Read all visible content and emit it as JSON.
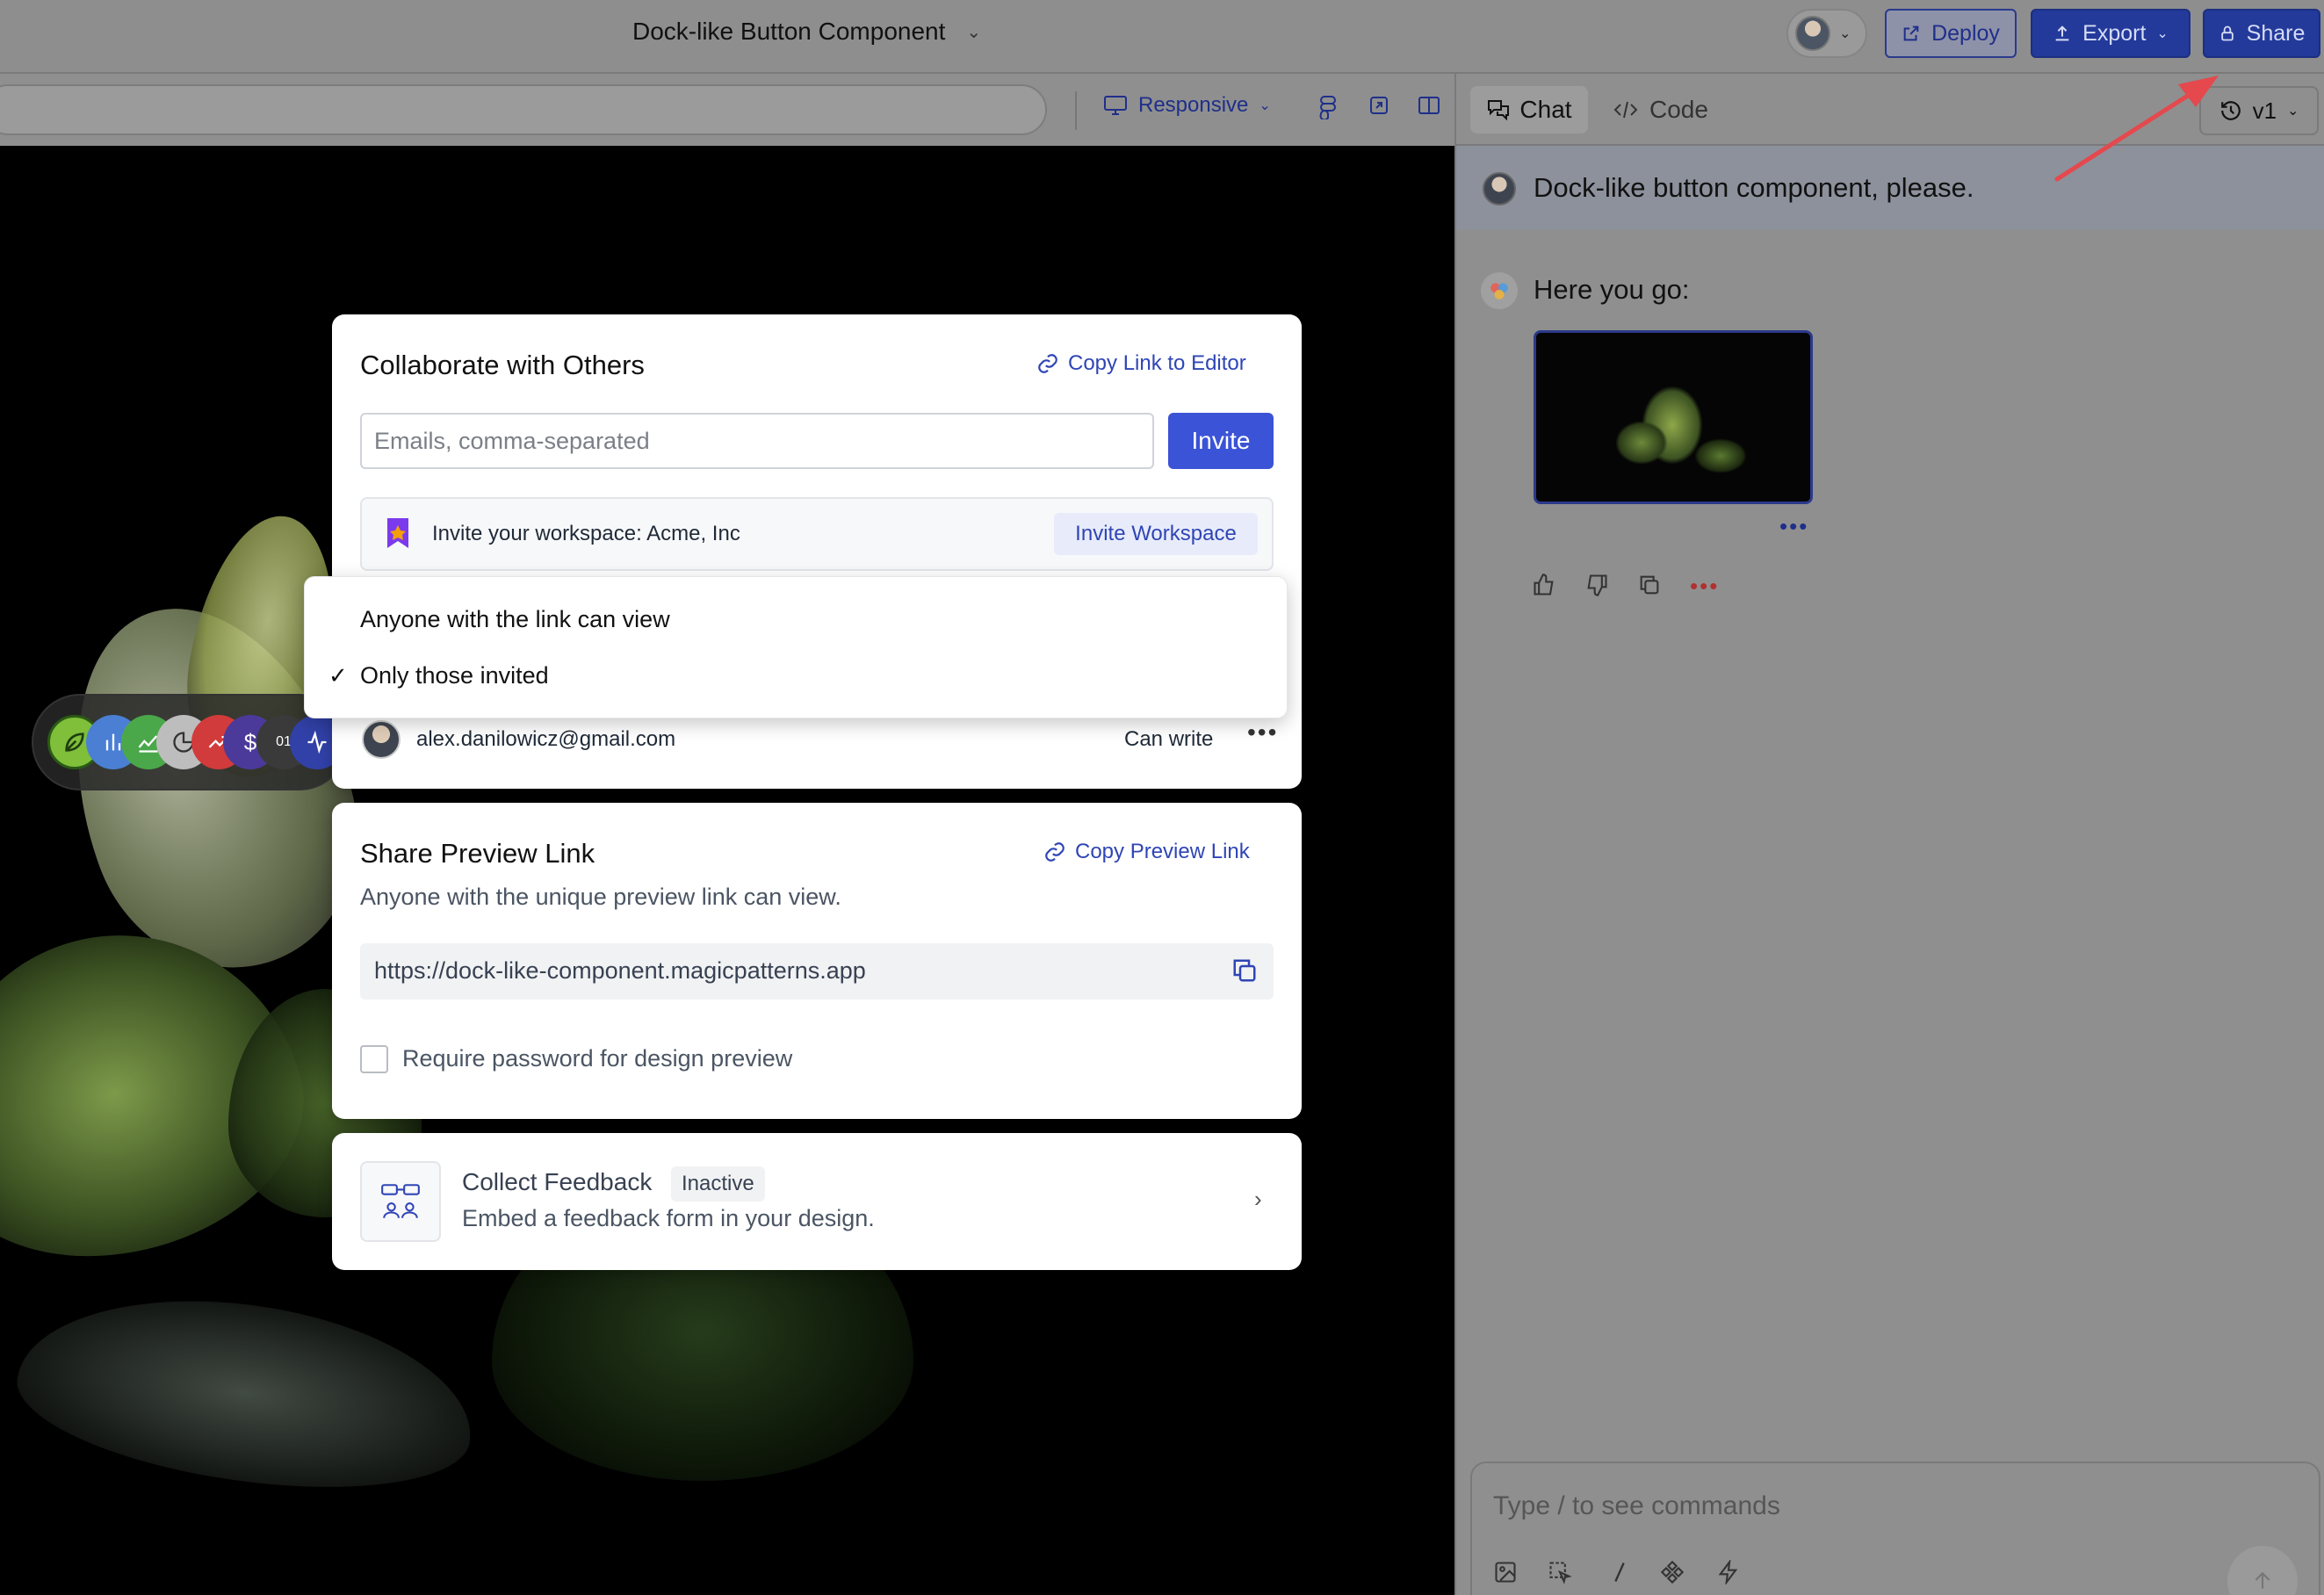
{
  "header": {
    "doc_title": "Dock-like Button Component",
    "deploy_label": "Deploy",
    "export_label": "Export",
    "share_label": "Share"
  },
  "toolbar": {
    "responsive_label": "Responsive",
    "tab_chat": "Chat",
    "tab_code": "Code",
    "version": "v1"
  },
  "chat": {
    "user_message": "Dock-like button component, please.",
    "bot_message": "Here you go:",
    "input_placeholder": "Type / to see commands"
  },
  "share_modal": {
    "collab_title": "Collaborate with Others",
    "copy_editor_link": "Copy Link to Editor",
    "email_placeholder": "Emails, comma-separated",
    "invite_label": "Invite",
    "workspace_text": "Invite your workspace: Acme, Inc",
    "invite_workspace_label": "Invite Workspace",
    "access_options": [
      {
        "label": "Anyone with the link can view",
        "selected": false
      },
      {
        "label": "Only those invited",
        "selected": true
      }
    ],
    "check_mark": "✓",
    "member": {
      "email": "alex.danilowicz@gmail.com",
      "role": "Can write"
    },
    "preview_title": "Share Preview Link",
    "copy_preview_link": "Copy Preview Link",
    "preview_desc": "Anyone with the unique preview link can view.",
    "preview_url": "https://dock-like-component.magicpatterns.app",
    "password_label": "Require password for design preview",
    "password_required": false,
    "feedback_title": "Collect Feedback",
    "feedback_status": "Inactive",
    "feedback_desc": "Embed a feedback form in your design."
  },
  "colors": {
    "accent": "#3b53d6",
    "link": "#2f45b5",
    "annotation_arrow": "#e5484d"
  },
  "icons": {
    "deploy": "external-link-icon",
    "export": "upload-icon",
    "share": "lock-icon",
    "responsive": "monitor-icon",
    "chat": "chat-bubbles-icon",
    "code": "code-icon",
    "version": "history-icon",
    "copy": "copy-icon",
    "link": "link-icon"
  }
}
